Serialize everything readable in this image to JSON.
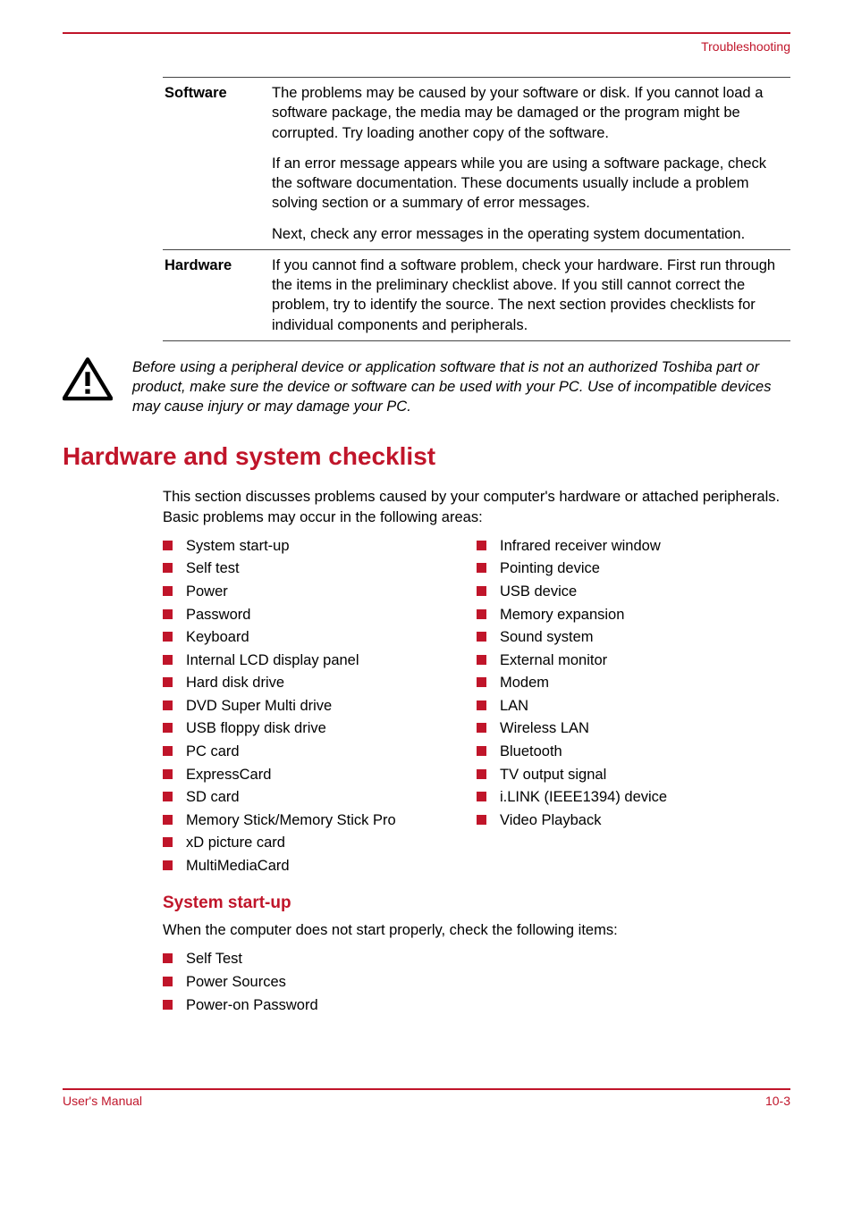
{
  "breadcrumb": "Troubleshooting",
  "table": {
    "row1": {
      "head": "Software",
      "p1": "The problems may be caused by your software or disk. If you cannot load a software package, the media may be damaged or the program might be corrupted. Try loading another copy of the software.",
      "p2": "If an error message appears while you are using a software package, check the software documentation. These documents usually include a problem solving section or a summary of error messages.",
      "p3": "Next, check any error messages in the operating system documentation."
    },
    "row2": {
      "head": "Hardware",
      "p1": "If you cannot find a software problem, check your hardware. First run through the items in the preliminary checklist above. If you still cannot correct the problem, try to identify the source. The next section provides checklists for individual components and peripherals."
    }
  },
  "warning": "Before using a peripheral device or application software that is not an authorized Toshiba part or product, make sure the device or software can be used with your PC. Use of incompatible devices may cause injury or may damage your PC.",
  "h1": "Hardware and system checklist",
  "intro": "This section discusses problems caused by your computer's hardware or attached peripherals. Basic problems may occur in the following areas:",
  "list_left": [
    "System start-up",
    "Self test",
    "Power",
    "Password",
    "Keyboard",
    "Internal LCD display panel",
    "Hard disk drive",
    "DVD Super Multi drive",
    "USB floppy disk drive",
    "PC card",
    "ExpressCard",
    "SD card",
    "Memory Stick/Memory Stick Pro",
    "xD picture card",
    "MultiMediaCard"
  ],
  "list_right": [
    "Infrared receiver window",
    "Pointing device",
    "USB device",
    "Memory expansion",
    "Sound system",
    "External monitor",
    "Modem",
    "LAN",
    "Wireless LAN",
    "Bluetooth",
    "TV output signal",
    "i.LINK (IEEE1394) device",
    "Video Playback"
  ],
  "h2": "System start-up",
  "intro2": "When the computer does not start properly, check the following items:",
  "list2": [
    "Self Test",
    "Power Sources",
    "Power-on Password"
  ],
  "footer_left": "User's Manual",
  "footer_right": "10-3"
}
